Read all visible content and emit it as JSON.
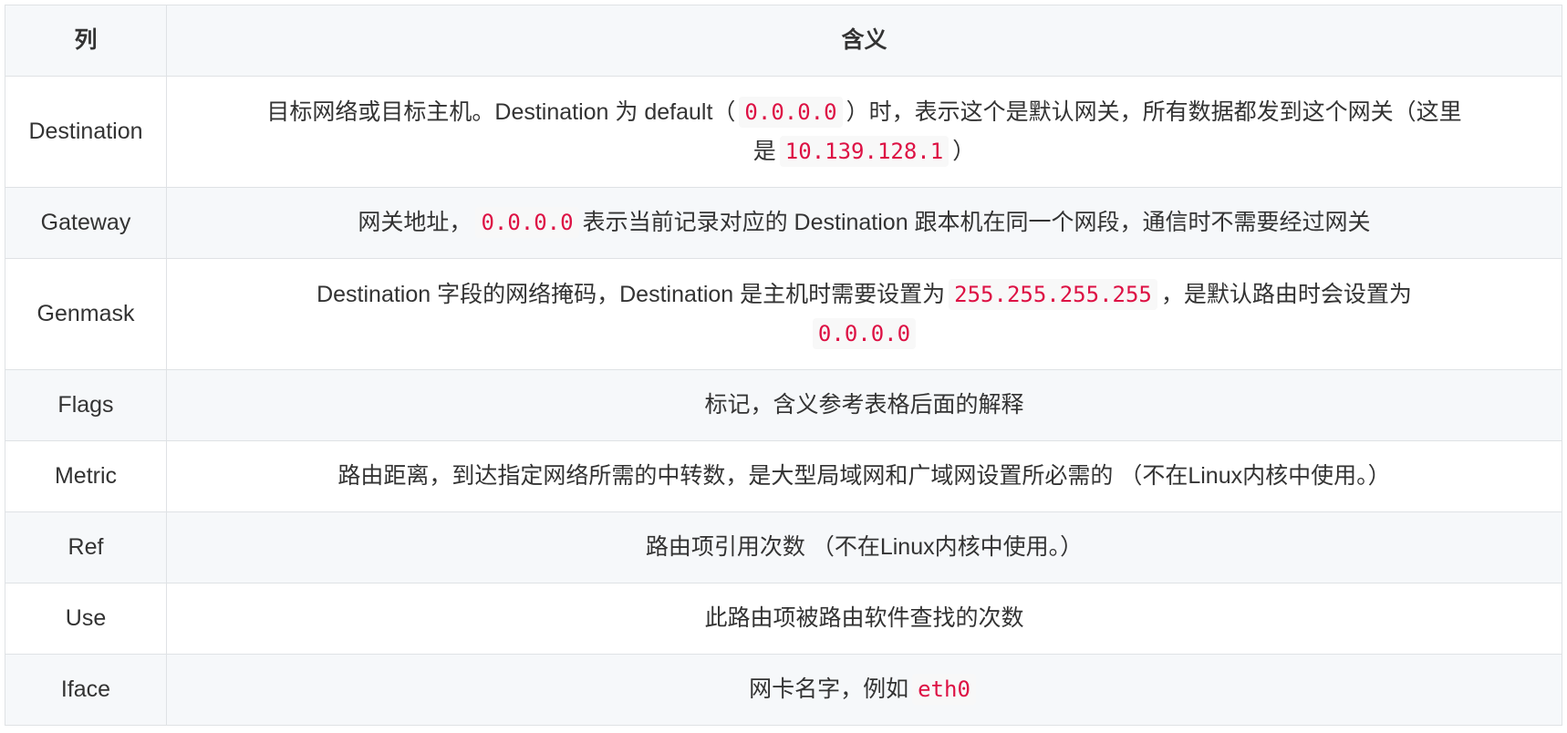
{
  "table": {
    "header": {
      "col1": "列",
      "col2": "含义"
    },
    "rows": [
      {
        "name": "Destination",
        "desc_line1_a": "目标网络或目标主机。Destination 为 default（",
        "desc_line1_code": "0.0.0.0",
        "desc_line1_b": "）时，表示这个是默认网关，所有数据都发到这个网关（这里",
        "desc_line2_a": "是",
        "desc_line2_code": "10.139.128.1",
        "desc_line2_b": "）"
      },
      {
        "name": "Gateway",
        "desc_a": "网关地址，",
        "desc_code": "0.0.0.0",
        "desc_b": "表示当前记录对应的 Destination 跟本机在同一个网段，通信时不需要经过网关"
      },
      {
        "name": "Genmask",
        "desc_line1_a": "Destination 字段的网络掩码，Destination 是主机时需要设置为",
        "desc_line1_code": "255.255.255.255",
        "desc_line1_b": "，是默认路由时会设置为",
        "desc_line2_code": "0.0.0.0"
      },
      {
        "name": "Flags",
        "desc": "标记，含义参考表格后面的解释"
      },
      {
        "name": "Metric",
        "desc": "路由距离，到达指定网络所需的中转数，是大型局域网和广域网设置所必需的 （不在Linux内核中使用。）"
      },
      {
        "name": "Ref",
        "desc": "路由项引用次数 （不在Linux内核中使用。）"
      },
      {
        "name": "Use",
        "desc": "此路由项被路由软件查找的次数"
      },
      {
        "name": "Iface",
        "desc_a": "网卡名字，例如",
        "desc_code": "eth0"
      }
    ]
  },
  "colors": {
    "border": "#dfe2e5",
    "stripe": "#f6f8fa",
    "code_text": "#dd1144",
    "text": "#333333"
  }
}
